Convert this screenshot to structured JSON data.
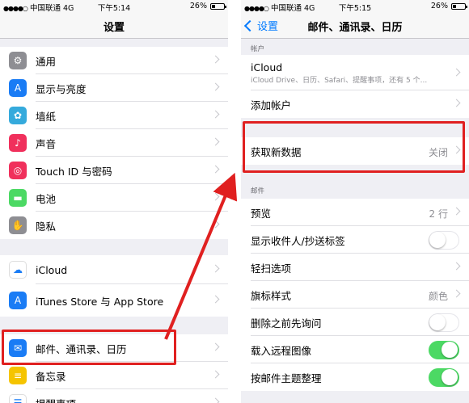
{
  "left_phone": {
    "status": {
      "carrier": "中国联通",
      "network": "4G",
      "time": "下午5:14",
      "battery": "26%"
    },
    "title": "设置",
    "group1": [
      {
        "label": "通用",
        "icon": "gear-icon",
        "color": "#8e8e93",
        "glyph": "⚙"
      },
      {
        "label": "显示与亮度",
        "icon": "display-icon",
        "color": "#1a7cf5",
        "glyph": "A"
      },
      {
        "label": "墙纸",
        "icon": "wallpaper-icon",
        "color": "#35aadc",
        "glyph": "✿"
      },
      {
        "label": "声音",
        "icon": "sound-icon",
        "color": "#f0305c",
        "glyph": "♪"
      },
      {
        "label": "Touch ID 与密码",
        "icon": "fingerprint-icon",
        "color": "#f0305c",
        "glyph": "◎"
      },
      {
        "label": "电池",
        "icon": "battery-icon",
        "color": "#4cd964",
        "glyph": "▬"
      },
      {
        "label": "隐私",
        "icon": "hand-icon",
        "color": "#8e8e93",
        "glyph": "✋"
      }
    ],
    "group2": [
      {
        "label": "iCloud",
        "icon": "icloud-icon",
        "color": "#ffffff",
        "glyph": "☁"
      },
      {
        "label": "iTunes Store 与 App Store",
        "icon": "appstore-icon",
        "color": "#1a7cf5",
        "glyph": "A"
      }
    ],
    "group3": [
      {
        "label": "邮件、通讯录、日历",
        "icon": "mail-icon",
        "color": "#1a7cf5",
        "glyph": "✉"
      },
      {
        "label": "备忘录",
        "icon": "notes-icon",
        "color": "#f5c400",
        "glyph": "≡"
      },
      {
        "label": "提醒事项",
        "icon": "reminders-icon",
        "color": "#ffffff",
        "glyph": "☰"
      }
    ]
  },
  "right_phone": {
    "status": {
      "carrier": "中国联通",
      "network": "4G",
      "time": "下午5:15",
      "battery": "26%"
    },
    "back_label": "设置",
    "title": "邮件、通讯录、日历",
    "accounts_header": "帐户",
    "icloud": {
      "label": "iCloud",
      "detail": "iCloud Drive、日历、Safari、提醒事项，还有 5 个..."
    },
    "add_account": "添加帐户",
    "fetch": {
      "label": "获取新数据",
      "value": "关闭"
    },
    "mail_header": "邮件",
    "mail_rows": [
      {
        "label": "预览",
        "value": "2 行",
        "type": "value"
      },
      {
        "label": "显示收件人/抄送标签",
        "type": "toggle",
        "on": false
      },
      {
        "label": "轻扫选项",
        "type": "chevron"
      },
      {
        "label": "旗标样式",
        "value": "颜色",
        "type": "value"
      },
      {
        "label": "删除之前先询问",
        "type": "toggle",
        "on": false
      },
      {
        "label": "载入远程图像",
        "type": "toggle",
        "on": true
      },
      {
        "label": "按邮件主题整理",
        "type": "toggle",
        "on": true
      }
    ]
  },
  "colors": {
    "highlight": "#e02020",
    "ios_blue": "#007aff",
    "toggle_on": "#4cd964"
  }
}
